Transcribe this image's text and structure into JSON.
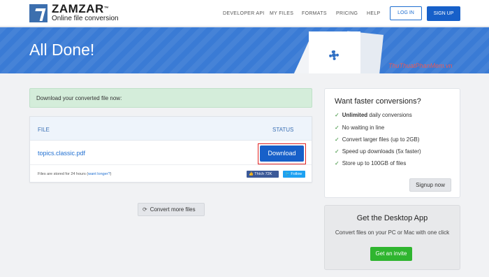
{
  "header": {
    "brand": "ZAMZAR",
    "trademark": "™",
    "tagline": "Online file conversion",
    "nav": [
      "DEVELOPER API",
      "MY FILES",
      "FORMATS",
      "PRICING",
      "HELP"
    ],
    "login": "LOG IN",
    "signup": "SIGN UP"
  },
  "banner": {
    "title": "All Done!",
    "watermark": "ThuThuatPhanMem.vn"
  },
  "main": {
    "notice": "Download your converted file now:",
    "columns": {
      "file": "FILE",
      "status": "STATUS"
    },
    "file_name": "topics.classic.pdf",
    "download": "Download",
    "storage_note": "Files are stored for 24 hours (",
    "want_longer": "want longer?",
    "storage_close": ")",
    "fb_like": "Thích 72K",
    "tw_follow": "Follow",
    "convert_more": "Convert more files"
  },
  "side_upgrade": {
    "title": "Want faster conversions?",
    "features": [
      {
        "bold": "Unlimited",
        "rest": " daily conversions"
      },
      {
        "bold": "",
        "rest": "No waiting in line"
      },
      {
        "bold": "",
        "rest": "Convert larger files (up to 2GB)"
      },
      {
        "bold": "",
        "rest": "Speed up downloads (5x faster)"
      },
      {
        "bold": "",
        "rest": "Store up to 100GB of files"
      }
    ],
    "check": "✓",
    "signup_now": "Signup now"
  },
  "side_desktop": {
    "title": "Get the Desktop App",
    "text": "Convert files on your PC or Mac with one click",
    "invite": "Get an invite"
  },
  "colors": {
    "primary": "#1760c9",
    "banner": "#3a7bd5",
    "success_bg": "#d4edda",
    "invite": "#2fb52f",
    "highlight": "#e02424"
  }
}
